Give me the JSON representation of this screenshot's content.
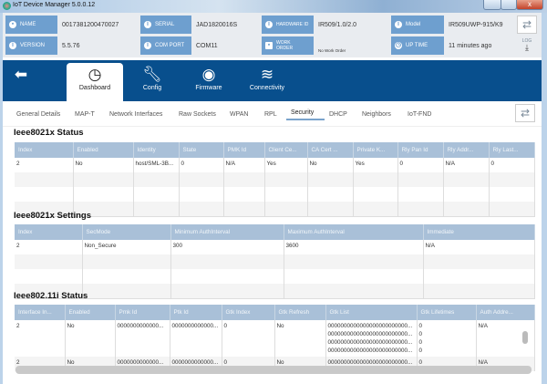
{
  "window": {
    "title": "IoT Device Manager 5.0.0.12",
    "close": "x"
  },
  "info": {
    "name": {
      "label": "NAME",
      "value": "00173812004700​27"
    },
    "serial": {
      "label": "SERIAL",
      "value": "JAD1820016S"
    },
    "hardware": {
      "label": "HARDWARE ID",
      "value": "IR509/1.0/2.0"
    },
    "model": {
      "label": "Model",
      "value": "IR509UWP-915/K9"
    },
    "version": {
      "label": "VERSION",
      "value": "5.5.76"
    },
    "comport": {
      "label": "COM PORT",
      "value": "COM11"
    },
    "workorder": {
      "label": "WORK ORDER",
      "value": "No Work Order"
    },
    "uptime": {
      "label": "UP TIME",
      "value": "11 minutes ago"
    },
    "log_label": "LOG"
  },
  "nav": {
    "tabs": [
      {
        "label": "Dashboard"
      },
      {
        "label": "Config"
      },
      {
        "label": "Firmware"
      },
      {
        "label": "Connectivity"
      }
    ]
  },
  "subtabs": [
    "General Details",
    "MAP-T",
    "Network Interfaces",
    "Raw Sockets",
    "WPAN",
    "RPL",
    "Security",
    "DHCP",
    "Neighbors",
    "IoT-FND"
  ],
  "sections": {
    "s1": {
      "title": "Ieee8021x Status",
      "columns": [
        "Index",
        "Enabled",
        "Identity",
        "State",
        "PMK Id",
        "Client Ce...",
        "CA Cert ...",
        "Private K...",
        "Rly Pan Id",
        "Rly Addr...",
        "Rly Last..."
      ],
      "rows": [
        [
          "2",
          "No",
          "host/SML-3B...",
          "0",
          "N/A",
          "Yes",
          "No",
          "Yes",
          "0",
          "N/A",
          "0"
        ]
      ]
    },
    "s2": {
      "title": "Ieee8021x Settings",
      "columns": [
        "Index",
        "SecMode",
        "Minimum AuthInterval",
        "Maximum AuthInterval",
        "Immediate"
      ],
      "rows": [
        [
          "2",
          "Non_Secure",
          "300",
          "3600",
          "N/A"
        ]
      ]
    },
    "s3": {
      "title": "Ieee802.11i Status",
      "columns": [
        "Interface In...",
        "Enabled",
        "Pmk Id",
        "Ptk Id",
        "Gtk Index",
        "Gtk Refresh",
        "Gtk List",
        "Gtk Lifetimes",
        "Auth Addre..."
      ],
      "rows": [
        [
          "2",
          "No",
          "0000000000000...",
          "0000000000000...",
          "0",
          "No",
          "0000000000000000000000000...",
          "0",
          "N/A"
        ],
        [
          "2",
          "No",
          "0000000000000...",
          "0000000000000...",
          "0",
          "No",
          "0000000000000000000000000...",
          "0",
          "N/A"
        ]
      ],
      "gtk_list_extra": [
        "0000000000000000000000000...",
        "0000000000000000000000000...",
        "0000000000000000000000000..."
      ],
      "gtk_lifetimes_extra": [
        "0",
        "0",
        "0"
      ]
    }
  }
}
